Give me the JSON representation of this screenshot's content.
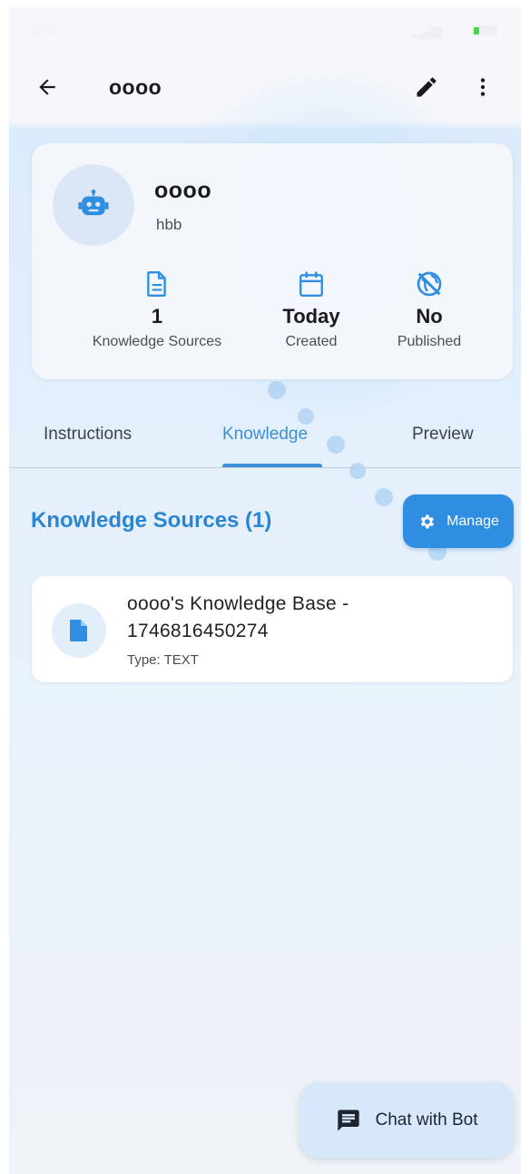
{
  "statusbar": {
    "time": "9:55"
  },
  "appbar": {
    "title": "oooo"
  },
  "profile": {
    "name": "oooo",
    "description": "hbb",
    "stats": [
      {
        "value": "1",
        "label": "Knowledge Sources"
      },
      {
        "value": "Today",
        "label": "Created"
      },
      {
        "value": "No",
        "label": "Published"
      }
    ]
  },
  "tabs": [
    {
      "label": "Instructions"
    },
    {
      "label": "Knowledge"
    },
    {
      "label": "Preview"
    }
  ],
  "knowledge": {
    "section_title": "Knowledge Sources (1)",
    "manage_label": "Manage",
    "sources": [
      {
        "title": "oooo's Knowledge Base - 1746816450274",
        "type": "Type: TEXT"
      }
    ]
  },
  "fab": {
    "label": "Chat with Bot"
  },
  "colors": {
    "accent": "#2f8ee0",
    "tab_active": "#3b8fd8"
  }
}
